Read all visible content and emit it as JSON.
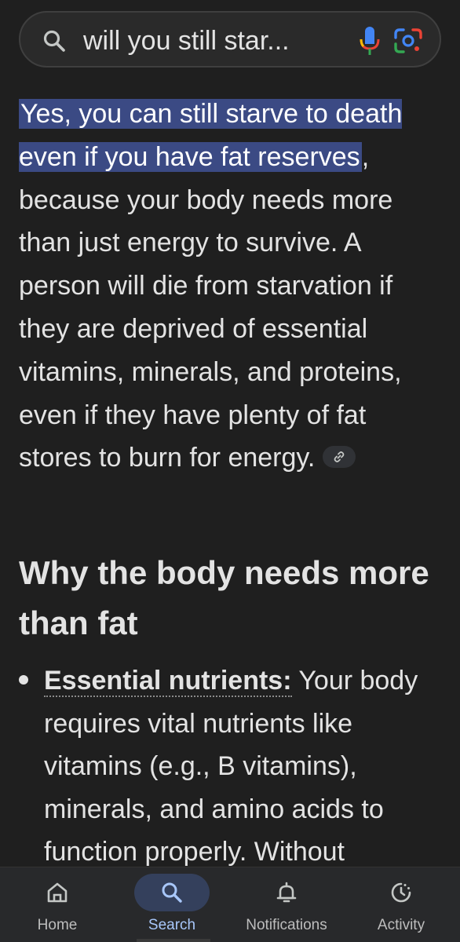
{
  "search": {
    "query": "will you still star..."
  },
  "answer": {
    "highlight_1": "Yes, you can still starve to death even if you have fat reserves",
    "body": ", because your body needs more than just energy to survive. A person will die from starvation if they are deprived of essential vitamins, minerals, and proteins, even if they have plenty of fat stores to burn for energy."
  },
  "section": {
    "heading": "Why the body needs more than fat"
  },
  "bullets": [
    {
      "term": "Essential nutrients:",
      "text": " Your body requires vital nutrients like vitamins (e.g., B vitamins), minerals, and amino acids to function properly. Without"
    }
  ],
  "nav": {
    "items": [
      {
        "label": "Home",
        "icon": "home-icon",
        "active": false
      },
      {
        "label": "Search",
        "icon": "search-icon",
        "active": true
      },
      {
        "label": "Notifications",
        "icon": "bell-icon",
        "active": false
      },
      {
        "label": "Activity",
        "icon": "activity-icon",
        "active": false
      }
    ]
  },
  "colors": {
    "background": "#1f1f1f",
    "highlight": "#3b4a84",
    "nav_active": "#34405c",
    "nav_active_label": "#a8c7fa"
  }
}
